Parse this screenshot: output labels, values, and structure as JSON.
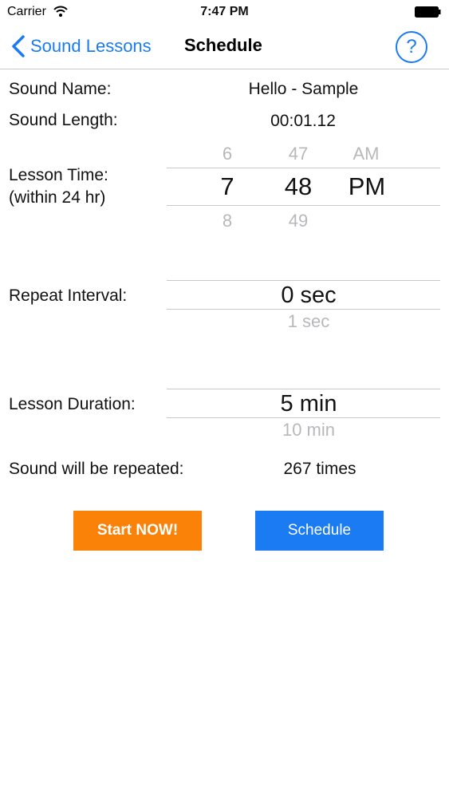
{
  "status_bar": {
    "carrier": "Carrier",
    "time": "7:47 PM"
  },
  "nav": {
    "back_label": "Sound Lessons",
    "title": "Schedule",
    "help_label": "?"
  },
  "sound_name": {
    "label": "Sound Name:",
    "value": "Hello - Sample"
  },
  "sound_length": {
    "label": "Sound Length:",
    "value": "00:01.12"
  },
  "lesson_time": {
    "label_line1": "Lesson Time:",
    "label_line2": "(within 24 hr)",
    "hour": {
      "prev": "6",
      "selected": "7",
      "next": "8"
    },
    "minute": {
      "prev": "47",
      "selected": "48",
      "next": "49"
    },
    "ampm": {
      "prev": "AM",
      "selected": "PM"
    }
  },
  "repeat_interval": {
    "label": "Repeat Interval:",
    "selected": "0 sec",
    "next": "1 sec"
  },
  "lesson_duration": {
    "label": "Lesson Duration:",
    "selected": "5 min",
    "next": "10 min"
  },
  "repeated": {
    "label": "Sound will be repeated:",
    "value": "267 times"
  },
  "buttons": {
    "start": "Start NOW!",
    "schedule": "Schedule"
  },
  "colors": {
    "accent": "#1a7bf2",
    "start_button": "#fb8209"
  }
}
